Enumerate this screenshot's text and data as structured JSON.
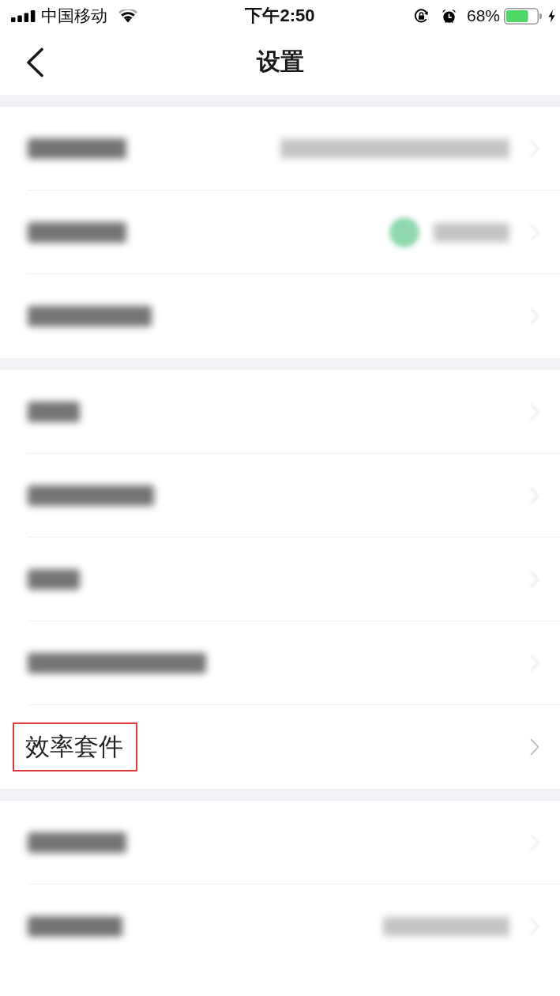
{
  "status_bar": {
    "carrier": "中国移动",
    "time": "下午2:50",
    "battery_percent": "68%"
  },
  "nav_bar": {
    "title": "设置"
  },
  "groups": [
    {
      "rows": [
        {
          "kind": "blurred",
          "status_dot": false,
          "value_shown": true,
          "highlighted": false
        },
        {
          "kind": "blurred",
          "status_dot": true,
          "value_shown": true,
          "highlighted": false
        },
        {
          "kind": "blurred",
          "status_dot": false,
          "value_shown": false,
          "highlighted": false
        }
      ]
    },
    {
      "rows": [
        {
          "kind": "blurred",
          "status_dot": false,
          "value_shown": false,
          "highlighted": false
        },
        {
          "kind": "blurred",
          "status_dot": false,
          "value_shown": false,
          "highlighted": false
        },
        {
          "kind": "blurred",
          "status_dot": false,
          "value_shown": false,
          "highlighted": false
        },
        {
          "kind": "blurred",
          "status_dot": false,
          "value_shown": false,
          "highlighted": false
        },
        {
          "kind": "label",
          "label": "效率套件",
          "status_dot": false,
          "value_shown": false,
          "highlighted": true
        }
      ]
    },
    {
      "rows": [
        {
          "kind": "blurred",
          "status_dot": false,
          "value_shown": false,
          "highlighted": false
        },
        {
          "kind": "blurred",
          "status_dot": false,
          "value_shown": true,
          "highlighted": false
        }
      ]
    }
  ]
}
